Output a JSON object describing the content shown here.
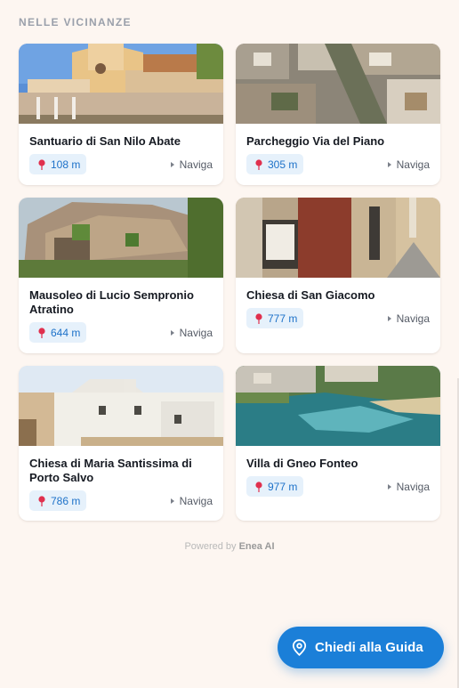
{
  "section": {
    "title": "NELLE VICINANZE"
  },
  "places": [
    {
      "name": "Santuario di San Nilo Abate",
      "distance": "108 m",
      "action": "Naviga"
    },
    {
      "name": "Parcheggio Via del Piano",
      "distance": "305 m",
      "action": "Naviga"
    },
    {
      "name": "Mausoleo di Lucio Sempronio Atratino",
      "distance": "644 m",
      "action": "Naviga"
    },
    {
      "name": "Chiesa di San Giacomo",
      "distance": "777 m",
      "action": "Naviga"
    },
    {
      "name": "Chiesa di Maria Santissima di Porto Salvo",
      "distance": "786 m",
      "action": "Naviga"
    },
    {
      "name": "Villa di Gneo Fonteo",
      "distance": "977 m",
      "action": "Naviga"
    }
  ],
  "footer": {
    "powered_prefix": "Powered by",
    "brand": "Enea AI"
  },
  "guide_button": {
    "label": "Chiedi alla Guida",
    "icon": "location-pin-icon"
  },
  "icons": {
    "distance": "map-pin-icon",
    "navigate": "play-triangle-icon"
  },
  "colors": {
    "accent": "#1b7fd8",
    "badge_bg": "#e6f1fb",
    "badge_text": "#1e72c9",
    "pin": "#e0304e",
    "page_bg": "#fdf6f1"
  }
}
